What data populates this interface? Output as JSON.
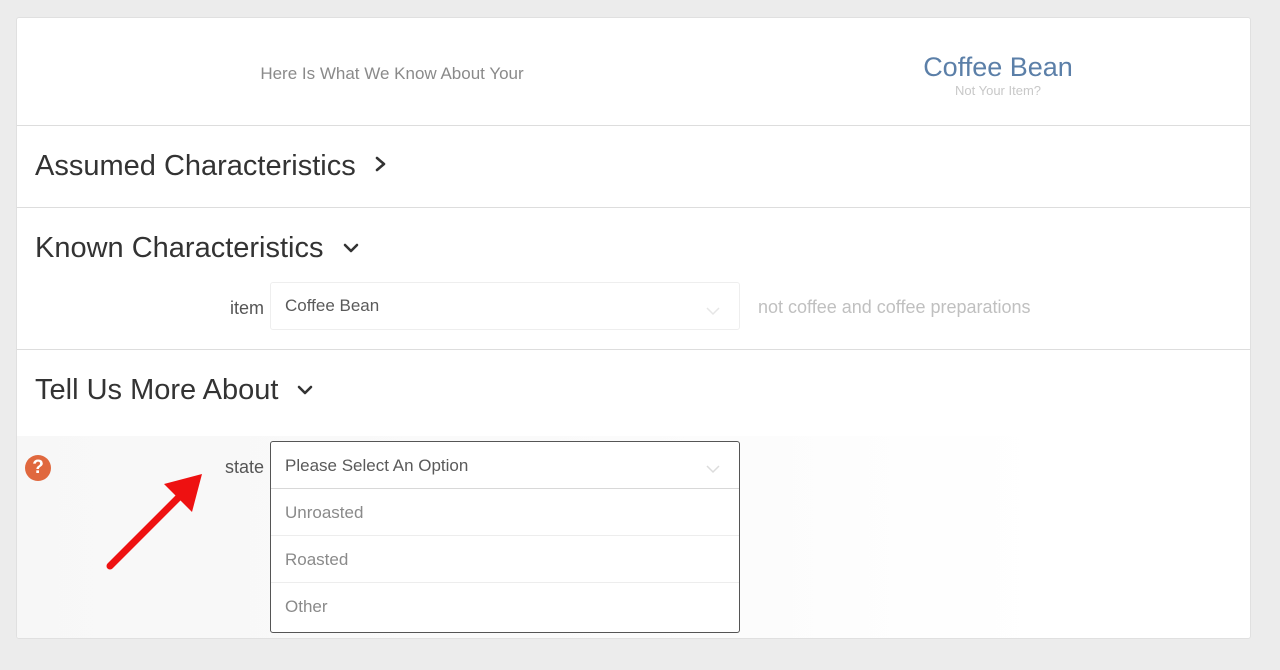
{
  "header": {
    "intro": "Here Is What We Know About Your",
    "item_name": "Coffee Bean",
    "not_item_link": "Not Your Item?"
  },
  "sections": {
    "assumed": {
      "title": "Assumed Characteristics",
      "state": "collapsed"
    },
    "known": {
      "title": "Known Characteristics",
      "state": "expanded",
      "field_label": "item",
      "field_value": "Coffee Bean",
      "note": "not coffee and coffee preparations"
    },
    "tell": {
      "title": "Tell Us More About",
      "state": "expanded",
      "field_label": "state",
      "placeholder": "Please Select An Option",
      "options": [
        "Unroasted",
        "Roasted",
        "Other"
      ]
    }
  },
  "icons": {
    "help": "question-circle-icon",
    "collapsed": "chevron-right-icon",
    "expanded": "chevron-down-icon",
    "annotation": "red-arrow"
  },
  "colors": {
    "item_name": "#5b7fa8",
    "help_icon": "#e0683e",
    "arrow": "#ee1111"
  }
}
